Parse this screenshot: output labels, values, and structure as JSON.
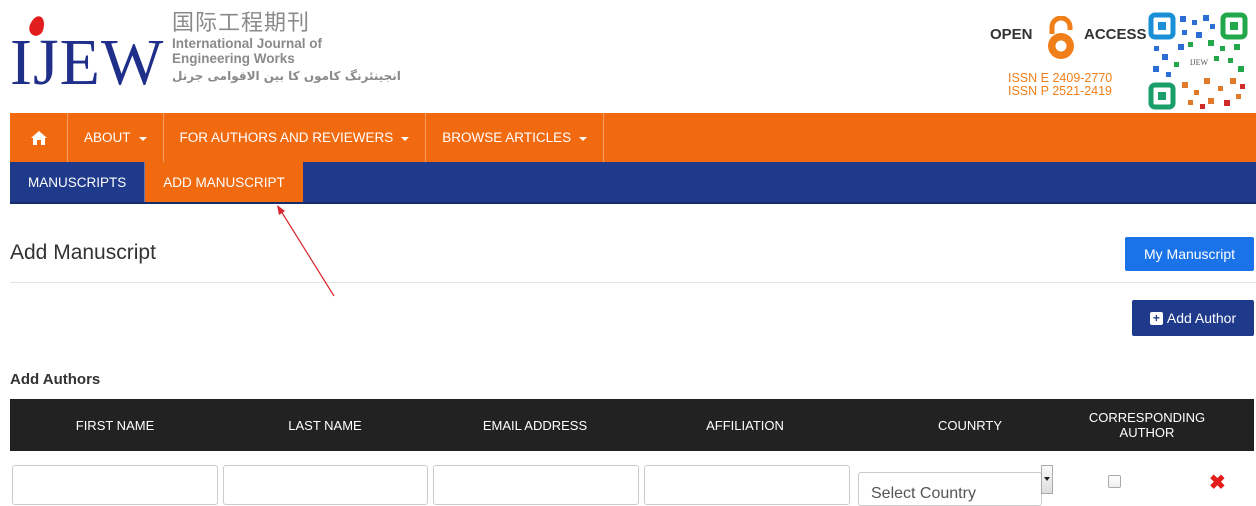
{
  "header": {
    "logo_mark": "IJEW",
    "logo_cn": "国际工程期刊",
    "logo_en_line1": "International Journal of",
    "logo_en_line2": "Engineering Works",
    "logo_ur": "انجینئرنگ کاموں کا بین الاقوامی جرنل",
    "open_label": "OPEN",
    "access_label": "ACCESS",
    "issn_e": "ISSN E 2409-2770",
    "issn_p": "ISSN P 2521-2419",
    "qr_label": "IJEW"
  },
  "nav": {
    "home_icon": "home-icon",
    "about": "ABOUT",
    "for_authors": "FOR AUTHORS AND REVIEWERS",
    "browse": "BROWSE ARTICLES"
  },
  "subnav": {
    "manuscripts": "MANUSCRIPTS",
    "add_manuscript": "ADD MANUSCRIPT"
  },
  "main": {
    "page_title": "Add Manuscript",
    "my_manuscript_button": "My Manuscript",
    "add_author_button": "Add Author",
    "section_title": "Add Authors"
  },
  "table": {
    "headers": {
      "first_name": "FIRST NAME",
      "last_name": "LAST NAME",
      "email": "EMAIL ADDRESS",
      "affiliation": "AFFILIATION",
      "country": "COUNRTY",
      "corresponding_line1": "CORRESPONDING",
      "corresponding_line2": "AUTHOR"
    },
    "row": {
      "first_name_value": "",
      "last_name_value": "",
      "email_value": "",
      "affiliation_value": "",
      "country_selected": "Select Country",
      "corresponding_checked": false
    }
  },
  "colors": {
    "orange": "#f26a0f",
    "navy": "#1f3a8a",
    "blue_button": "#1a73e8",
    "table_header": "#222222",
    "delete_red": "#e51c1c",
    "annotation_red": "#d9262c"
  }
}
